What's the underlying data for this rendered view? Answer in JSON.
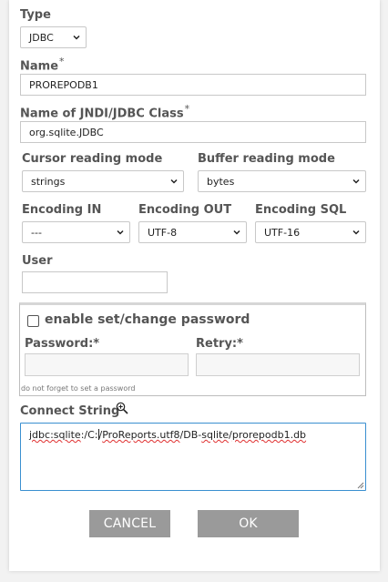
{
  "form": {
    "type": {
      "label": "Type",
      "value": "JDBC"
    },
    "name": {
      "label": "Name",
      "required_mark": "*",
      "value": "PROREPODB1"
    },
    "class": {
      "label": "Name of JNDI/JDBC Class",
      "required_mark": "*",
      "value": "org.sqlite.JDBC"
    },
    "cursor_mode": {
      "label": "Cursor reading mode",
      "value": "strings"
    },
    "buffer_mode": {
      "label": "Buffer reading mode",
      "value": "bytes"
    },
    "encoding_in": {
      "label": "Encoding IN",
      "value": "---"
    },
    "encoding_out": {
      "label": "Encoding OUT",
      "value": "UTF-8"
    },
    "encoding_sql": {
      "label": "Encoding SQL",
      "value": "UTF-16"
    },
    "user": {
      "label": "User",
      "value": ""
    },
    "password_section": {
      "checkbox_label": "enable set/change password",
      "checked": false,
      "password_label": "Password:*",
      "retry_label": "Retry:*",
      "hint": "do not forget to set a password"
    },
    "connect": {
      "label": "Connect String",
      "icon": "zoom-in-icon",
      "parts": [
        "jdbc:sqlite",
        ":/C:",
        "/",
        "ProReports.utf8",
        "/DB-",
        "sqlite",
        "/",
        "prorepodb1.db"
      ]
    }
  },
  "buttons": {
    "cancel": "CANCEL",
    "ok": "OK"
  },
  "colors": {
    "button_bg": "#9a9a9a",
    "focus_border": "#3a8fd0",
    "spellcheck": "#e03030"
  }
}
